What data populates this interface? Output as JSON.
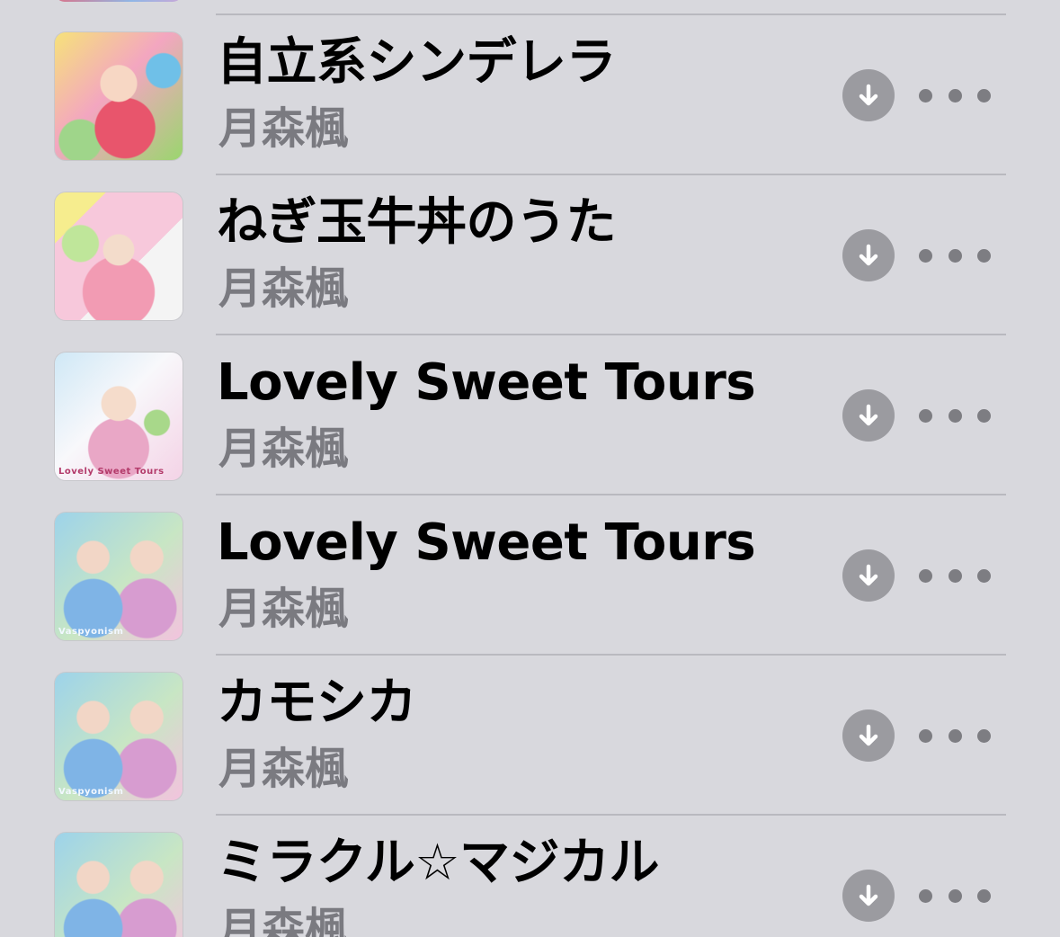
{
  "songs": [
    {
      "title": "自立系シンデレラ",
      "artist": "月森楓",
      "art_text": ""
    },
    {
      "title": "ねぎ玉牛丼のうた",
      "artist": "月森楓",
      "art_text": ""
    },
    {
      "title": "Lovely Sweet Tours",
      "artist": "月森楓",
      "art_text": "Lovely Sweet Tours"
    },
    {
      "title": "Lovely Sweet Tours",
      "artist": "月森楓",
      "art_text": "Vaspyonism"
    },
    {
      "title": "カモシカ",
      "artist": "月森楓",
      "art_text": "Vaspyonism"
    },
    {
      "title": "ミラクル☆マジカル",
      "artist": "月森楓",
      "art_text": ""
    }
  ],
  "icons": {
    "download": "download-circle-arrow-icon",
    "more": "ellipsis-icon"
  },
  "colors": {
    "background": "#d8d8dd",
    "title": "#000000",
    "artist": "#7a7a80",
    "download_circle": "#9b9ba0",
    "more_dots": "#7d7d82",
    "separator": "#b9b9bf"
  }
}
